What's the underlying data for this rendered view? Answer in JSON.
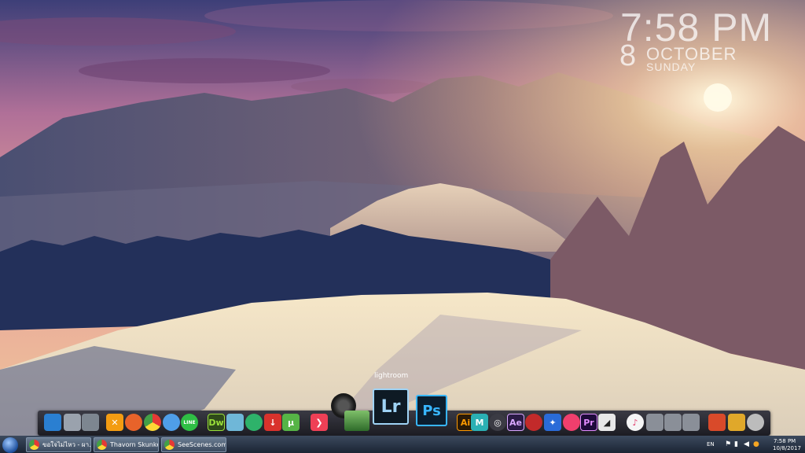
{
  "desktop": {
    "clock": {
      "time": "7:58 PM",
      "day": "8",
      "month": "OCTOBER",
      "weekday": "SUNDAY"
    },
    "colors": {
      "sky_top": "#3a3f78",
      "sky_pink": "#d58aa0",
      "sun": "#ffe9b8",
      "snow": "#f3e2c4",
      "forest": "#1d2a4a"
    }
  },
  "dock": {
    "tooltip": "lightroom",
    "lightroom_label": "Lr",
    "photoshop_label": "Ps",
    "illustrator_label": "Ai",
    "dreamweaver_label": "Dw",
    "aftereffects_label": "Ae",
    "premiere_label": "Pr",
    "maya_label": "M"
  },
  "taskbar": {
    "items": [
      {
        "label": "ขอใจไม่ไหว - ผา..."
      },
      {
        "label": "Thavorn Skunkess..."
      },
      {
        "label": "SeeScenes.com |..."
      }
    ],
    "tray": {
      "lang": "EN",
      "time": "7:58 PM",
      "date": "10/8/2017"
    }
  }
}
